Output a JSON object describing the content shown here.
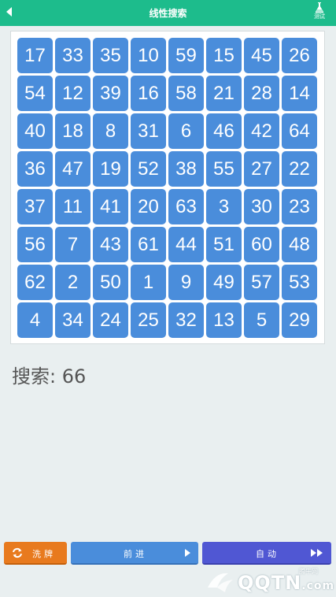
{
  "header": {
    "title": "线性搜索",
    "test_label": "测试"
  },
  "grid": {
    "values": [
      17,
      33,
      35,
      10,
      59,
      15,
      45,
      26,
      54,
      12,
      39,
      16,
      58,
      21,
      28,
      14,
      40,
      18,
      8,
      31,
      6,
      46,
      42,
      64,
      36,
      47,
      19,
      52,
      38,
      55,
      27,
      22,
      37,
      11,
      41,
      20,
      63,
      3,
      30,
      23,
      56,
      7,
      43,
      61,
      44,
      51,
      60,
      48,
      62,
      2,
      50,
      1,
      9,
      49,
      57,
      53,
      4,
      34,
      24,
      25,
      32,
      13,
      5,
      29
    ]
  },
  "status": {
    "search_text": "搜索: 66"
  },
  "buttons": {
    "shuffle_label": "洗牌",
    "forward_label": "前进",
    "auto_label": "自动"
  },
  "watermark": {
    "text": "QQTN",
    "suffix": ".com",
    "small_text": "腾牛网"
  },
  "colors": {
    "header": "#1dbc8c",
    "cell": "#4a8ddb",
    "shuffle": "#e87a1e",
    "forward": "#4a8ddb",
    "auto": "#5057d3"
  }
}
